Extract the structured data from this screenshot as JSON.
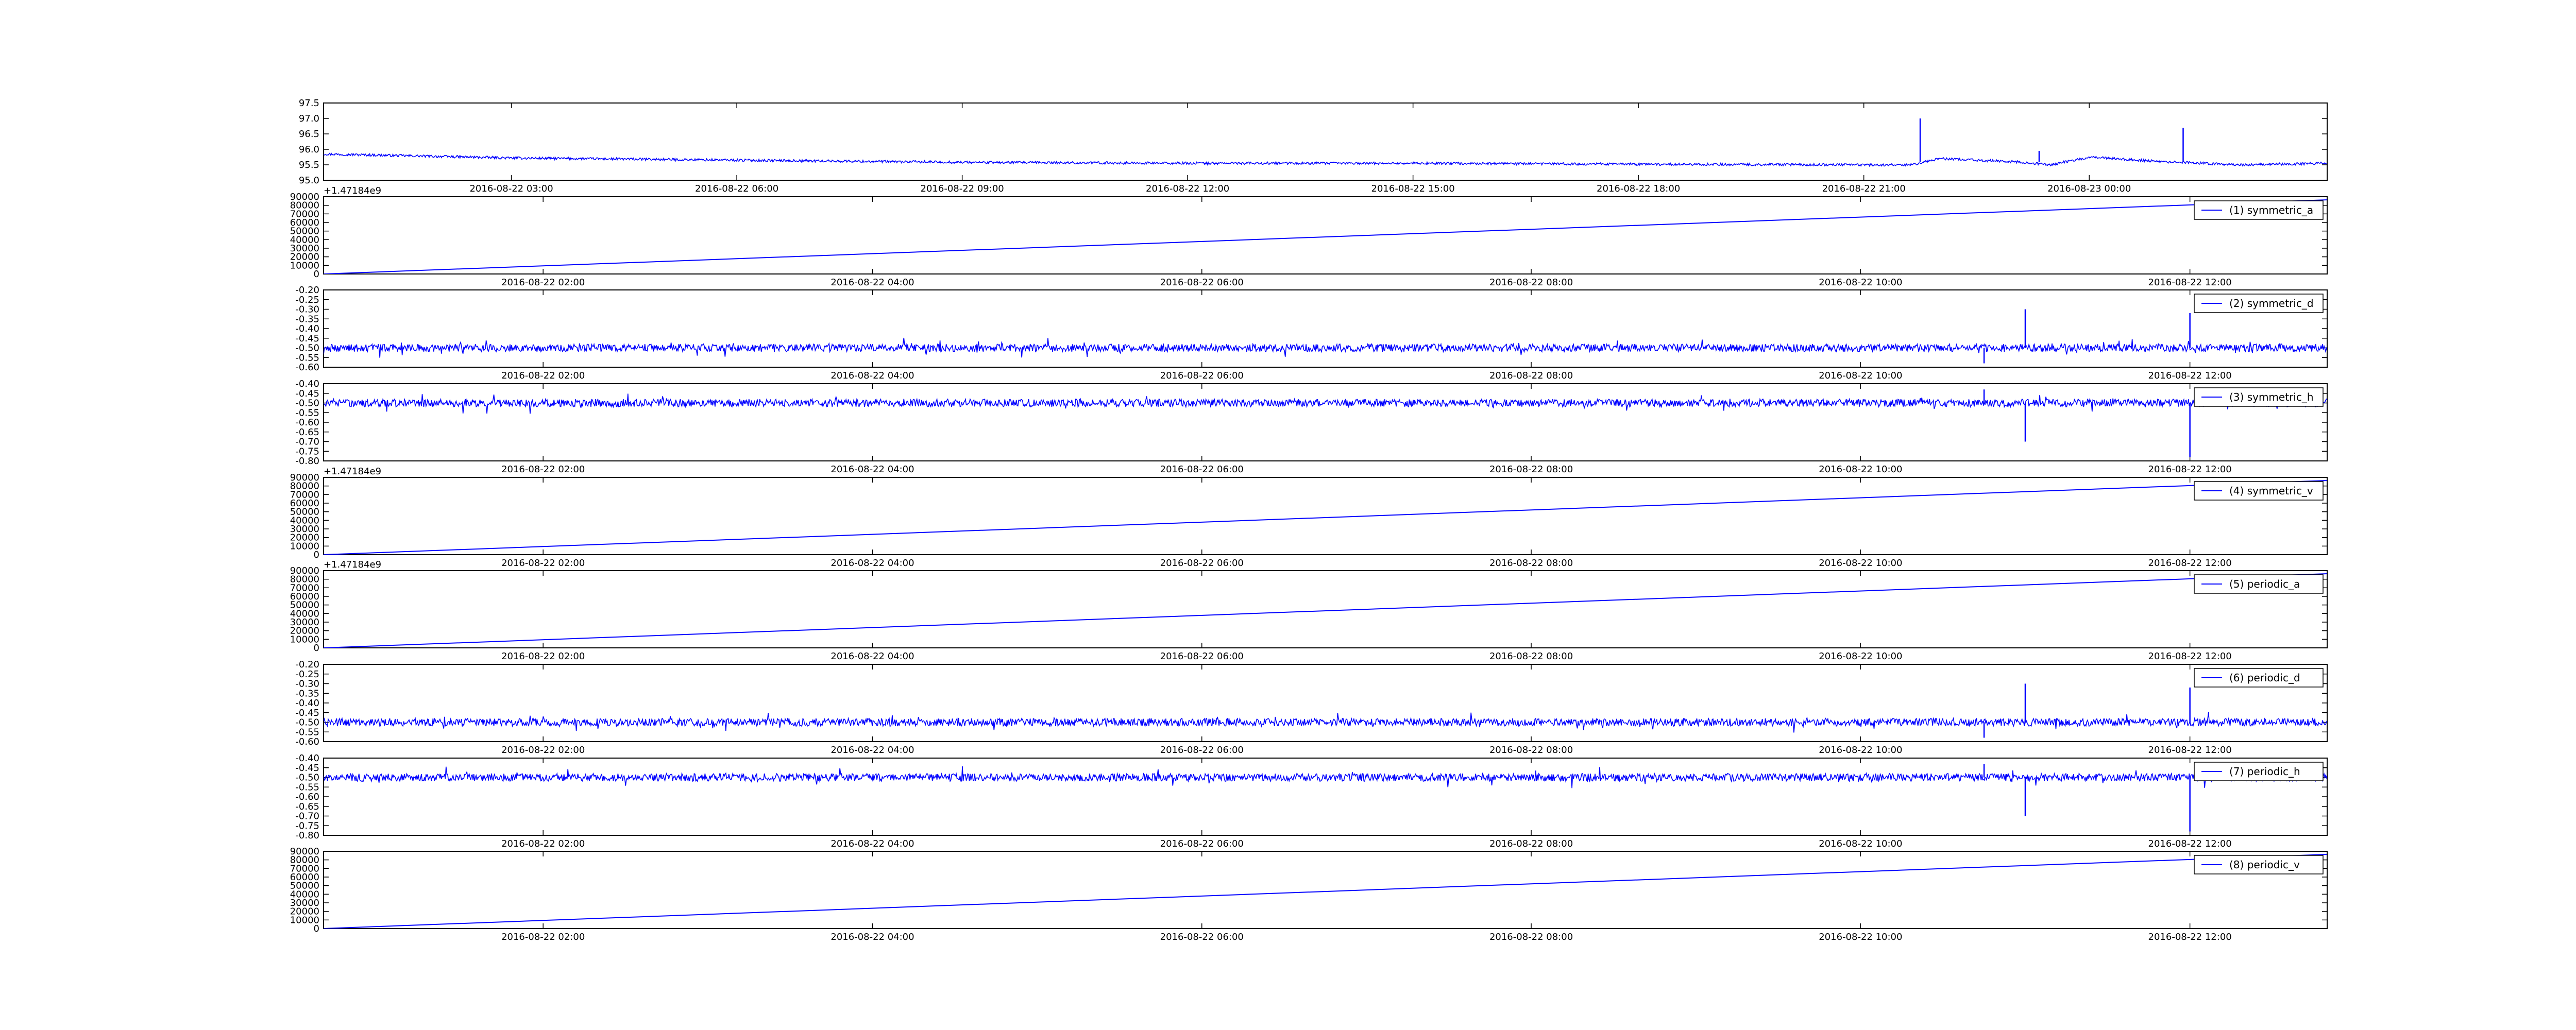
{
  "chart_data": [
    {
      "type": "line",
      "x_axis": "date",
      "x_range": [
        "2016-08-22 00:30",
        "2016-08-23 03:10"
      ],
      "x_ticks": [
        "2016-08-22 03:00",
        "2016-08-22 06:00",
        "2016-08-22 09:00",
        "2016-08-22 12:00",
        "2016-08-22 15:00",
        "2016-08-22 18:00",
        "2016-08-22 21:00",
        "2016-08-23 00:00"
      ],
      "ylim": [
        95.0,
        97.5
      ],
      "y_ticks": [
        "95.0",
        "95.5",
        "96.0",
        "96.5",
        "97.0",
        "97.5"
      ],
      "color": "#0000ff",
      "series": [
        {
          "x": [
            "2016-08-22 00:30",
            "2016-08-22 03:00",
            "2016-08-22 06:00",
            "2016-08-22 09:00",
            "2016-08-22 12:00",
            "2016-08-22 15:00",
            "2016-08-22 18:00",
            "2016-08-22 21:00",
            "2016-08-22 21:40",
            "2016-08-22 22:00",
            "2016-08-22 23:00",
            "2016-08-22 23:30",
            "2016-08-23 00:00",
            "2016-08-23 01:00",
            "2016-08-23 02:00",
            "2016-08-23 03:10"
          ],
          "values": [
            95.85,
            95.72,
            95.65,
            95.58,
            95.55,
            95.55,
            95.52,
            95.5,
            95.5,
            95.7,
            95.6,
            95.5,
            95.75,
            95.6,
            95.5,
            95.55
          ],
          "spikes": [
            {
              "x": "2016-08-22 21:45",
              "y": 97.0
            },
            {
              "x": "2016-08-22 23:20",
              "y": 95.95
            },
            {
              "x": "2016-08-23 01:15",
              "y": 96.7
            }
          ]
        }
      ]
    },
    {
      "type": "line",
      "x_axis": "date",
      "x_range": [
        "2016-08-22 00:40",
        "2016-08-22 12:50"
      ],
      "x_ticks": [
        "2016-08-22 02:00",
        "2016-08-22 04:00",
        "2016-08-22 06:00",
        "2016-08-22 08:00",
        "2016-08-22 10:00",
        "2016-08-22 12:00"
      ],
      "ylim": [
        0,
        90000
      ],
      "y_ticks": [
        "0",
        "10000",
        "20000",
        "30000",
        "40000",
        "50000",
        "60000",
        "70000",
        "80000",
        "90000"
      ],
      "offset_label": "+1.47184e9",
      "legend_loc": "upper right",
      "color": "#0000ff",
      "series": [
        {
          "name": "(1) symmetric_a",
          "style": "ramp",
          "values": [
            0,
            86400
          ]
        }
      ]
    },
    {
      "type": "line",
      "x_axis": "date",
      "x_range": [
        "2016-08-22 00:40",
        "2016-08-22 12:50"
      ],
      "x_ticks": [
        "2016-08-22 02:00",
        "2016-08-22 04:00",
        "2016-08-22 06:00",
        "2016-08-22 08:00",
        "2016-08-22 10:00",
        "2016-08-22 12:00"
      ],
      "ylim": [
        -0.6,
        -0.2
      ],
      "y_ticks": [
        "-0.60",
        "-0.55",
        "-0.50",
        "-0.45",
        "-0.40",
        "-0.35",
        "-0.30",
        "-0.25",
        "-0.20"
      ],
      "legend_loc": "upper right",
      "color": "#0000ff",
      "series": [
        {
          "name": "(2) symmetric_d",
          "style": "noise",
          "baseline": -0.5,
          "amplitude": 0.02,
          "spikes": [
            {
              "x": "2016-08-22 11:00",
              "y": -0.3
            },
            {
              "x": "2016-08-22 12:00",
              "y": -0.32
            },
            {
              "x": "2016-08-22 10:45",
              "y": -0.58
            }
          ]
        }
      ]
    },
    {
      "type": "line",
      "x_axis": "date",
      "x_range": [
        "2016-08-22 00:40",
        "2016-08-22 12:50"
      ],
      "x_ticks": [
        "2016-08-22 02:00",
        "2016-08-22 04:00",
        "2016-08-22 06:00",
        "2016-08-22 08:00",
        "2016-08-22 10:00",
        "2016-08-22 12:00"
      ],
      "ylim": [
        -0.8,
        -0.4
      ],
      "y_ticks": [
        "-0.80",
        "-0.75",
        "-0.70",
        "-0.65",
        "-0.60",
        "-0.55",
        "-0.50",
        "-0.45",
        "-0.40"
      ],
      "legend_loc": "upper right",
      "color": "#0000ff",
      "series": [
        {
          "name": "(3) symmetric_h",
          "style": "noise",
          "baseline": -0.5,
          "amplitude": 0.02,
          "spikes": [
            {
              "x": "2016-08-22 11:00",
              "y": -0.7
            },
            {
              "x": "2016-08-22 12:00",
              "y": -0.78
            },
            {
              "x": "2016-08-22 10:45",
              "y": -0.43
            }
          ]
        }
      ]
    },
    {
      "type": "line",
      "x_axis": "date",
      "x_range": [
        "2016-08-22 00:40",
        "2016-08-22 12:50"
      ],
      "x_ticks": [
        "2016-08-22 02:00",
        "2016-08-22 04:00",
        "2016-08-22 06:00",
        "2016-08-22 08:00",
        "2016-08-22 10:00",
        "2016-08-22 12:00"
      ],
      "ylim": [
        0,
        90000
      ],
      "y_ticks": [
        "0",
        "10000",
        "20000",
        "30000",
        "40000",
        "50000",
        "60000",
        "70000",
        "80000",
        "90000"
      ],
      "offset_label": "+1.47184e9",
      "legend_loc": "upper right",
      "color": "#0000ff",
      "series": [
        {
          "name": "(4) symmetric_v",
          "style": "ramp",
          "values": [
            0,
            86400
          ]
        }
      ]
    },
    {
      "type": "line",
      "x_axis": "date",
      "x_range": [
        "2016-08-22 00:40",
        "2016-08-22 12:50"
      ],
      "x_ticks": [
        "2016-08-22 02:00",
        "2016-08-22 04:00",
        "2016-08-22 06:00",
        "2016-08-22 08:00",
        "2016-08-22 10:00",
        "2016-08-22 12:00"
      ],
      "ylim": [
        0,
        90000
      ],
      "y_ticks": [
        "0",
        "10000",
        "20000",
        "30000",
        "40000",
        "50000",
        "60000",
        "70000",
        "80000",
        "90000"
      ],
      "offset_label": "+1.47184e9",
      "legend_loc": "upper right",
      "color": "#0000ff",
      "series": [
        {
          "name": "(5) periodic_a",
          "style": "ramp",
          "values": [
            0,
            86400
          ]
        }
      ]
    },
    {
      "type": "line",
      "x_axis": "date",
      "x_range": [
        "2016-08-22 00:40",
        "2016-08-22 12:50"
      ],
      "x_ticks": [
        "2016-08-22 02:00",
        "2016-08-22 04:00",
        "2016-08-22 06:00",
        "2016-08-22 08:00",
        "2016-08-22 10:00",
        "2016-08-22 12:00"
      ],
      "ylim": [
        -0.6,
        -0.2
      ],
      "y_ticks": [
        "-0.60",
        "-0.55",
        "-0.50",
        "-0.45",
        "-0.40",
        "-0.35",
        "-0.30",
        "-0.25",
        "-0.20"
      ],
      "legend_loc": "upper right",
      "color": "#0000ff",
      "series": [
        {
          "name": "(6) periodic_d",
          "style": "noise",
          "baseline": -0.5,
          "amplitude": 0.02,
          "spikes": [
            {
              "x": "2016-08-22 11:00",
              "y": -0.3
            },
            {
              "x": "2016-08-22 12:00",
              "y": -0.32
            },
            {
              "x": "2016-08-22 10:45",
              "y": -0.58
            }
          ]
        }
      ]
    },
    {
      "type": "line",
      "x_axis": "date",
      "x_range": [
        "2016-08-22 00:40",
        "2016-08-22 12:50"
      ],
      "x_ticks": [
        "2016-08-22 02:00",
        "2016-08-22 04:00",
        "2016-08-22 06:00",
        "2016-08-22 08:00",
        "2016-08-22 10:00",
        "2016-08-22 12:00"
      ],
      "ylim": [
        -0.8,
        -0.4
      ],
      "y_ticks": [
        "-0.80",
        "-0.75",
        "-0.70",
        "-0.65",
        "-0.60",
        "-0.55",
        "-0.50",
        "-0.45",
        "-0.40"
      ],
      "legend_loc": "upper right",
      "color": "#0000ff",
      "series": [
        {
          "name": "(7) periodic_h",
          "style": "noise",
          "baseline": -0.5,
          "amplitude": 0.02,
          "spikes": [
            {
              "x": "2016-08-22 11:00",
              "y": -0.7
            },
            {
              "x": "2016-08-22 12:00",
              "y": -0.78
            },
            {
              "x": "2016-08-22 10:45",
              "y": -0.43
            }
          ]
        }
      ]
    },
    {
      "type": "line",
      "x_axis": "date",
      "x_range": [
        "2016-08-22 00:40",
        "2016-08-22 12:50"
      ],
      "x_ticks": [
        "2016-08-22 02:00",
        "2016-08-22 04:00",
        "2016-08-22 06:00",
        "2016-08-22 08:00",
        "2016-08-22 10:00",
        "2016-08-22 12:00"
      ],
      "ylim": [
        0,
        90000
      ],
      "y_ticks": [
        "0",
        "10000",
        "20000",
        "30000",
        "40000",
        "50000",
        "60000",
        "70000",
        "80000",
        "90000"
      ],
      "legend_loc": "upper right",
      "color": "#0000ff",
      "series": [
        {
          "name": "(8) periodic_v",
          "style": "ramp",
          "values": [
            0,
            86400
          ]
        }
      ]
    }
  ]
}
